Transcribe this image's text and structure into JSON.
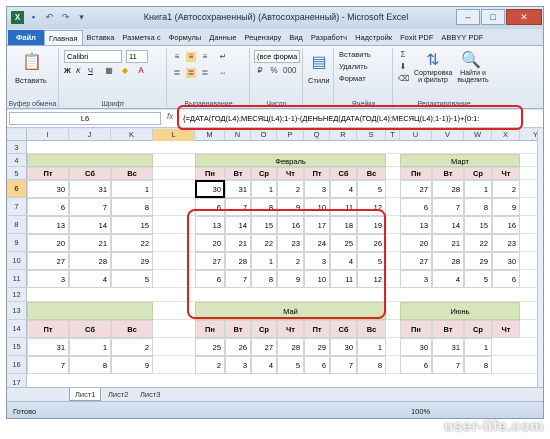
{
  "title": "Книга1 (Автосохраненный) (Автосохраненный) - Microsoft Excel",
  "tabs": [
    "Файл",
    "Главная",
    "Вставка",
    "Разметка с",
    "Формулы",
    "Данные",
    "Рецензиру",
    "Вид",
    "Разработч",
    "Надстройк",
    "Foxit PDF",
    "ABBYY PDF"
  ],
  "ribbon": {
    "paste": "Вставить",
    "clipboard": "Буфер обмена",
    "font_name": "Calibri",
    "font_size": "11",
    "font": "Шрифт",
    "alignment": "Выравнивание",
    "number_format": "(все форма",
    "number": "Число",
    "styles": "Стили",
    "insert": "Вставить",
    "delete": "Удалить",
    "format": "Формат",
    "cells": "Ячейки",
    "sort": "Сортировка и фильтр",
    "find": "Найти и выделить",
    "editing": "Редактирование"
  },
  "namebox": "L6",
  "formula": "{=ДАТА(ГОД(L4);МЕСЯЦ(L4);1-1)-(ДЕНЬНЕД(ДАТА(ГОД(L4);МЕСЯЦ(L4);1-1))-1)+{0:1:",
  "columns": [
    "I",
    "J",
    "K",
    "L",
    "M",
    "N",
    "O",
    "P",
    "Q",
    "R",
    "S",
    "T",
    "U",
    "V",
    "W",
    "X",
    "Y"
  ],
  "rows": [
    "3",
    "4",
    "5",
    "6",
    "7",
    "8",
    "9",
    "10",
    "11",
    "12",
    "13",
    "14",
    "15",
    "16",
    "17"
  ],
  "days": [
    "Пн",
    "Вт",
    "Ср",
    "Чт",
    "Пт",
    "Сб",
    "Вс"
  ],
  "months": {
    "feb": "Февраль",
    "mar": "Март",
    "may": "Май",
    "jun": "Июнь"
  },
  "left_block": {
    "days": [
      "Пт",
      "Сб",
      "Вс"
    ],
    "rows": [
      [
        "30",
        "31",
        "1"
      ],
      [
        "6",
        "7",
        "8"
      ],
      [
        "13",
        "14",
        "15"
      ],
      [
        "20",
        "21",
        "22"
      ],
      [
        "27",
        "28",
        "29"
      ],
      [
        "3",
        "4",
        "5"
      ]
    ]
  },
  "feb_block": [
    [
      "30",
      "31",
      "1",
      "2",
      "3",
      "4",
      "5"
    ],
    [
      "6",
      "7",
      "8",
      "9",
      "10",
      "11",
      "12"
    ],
    [
      "13",
      "14",
      "15",
      "16",
      "17",
      "18",
      "19"
    ],
    [
      "20",
      "21",
      "22",
      "23",
      "24",
      "25",
      "26"
    ],
    [
      "27",
      "28",
      "1",
      "2",
      "3",
      "4",
      "5"
    ],
    [
      "6",
      "7",
      "8",
      "9",
      "10",
      "11",
      "12"
    ]
  ],
  "mar_block": [
    [
      "27",
      "28",
      "1",
      "2"
    ],
    [
      "6",
      "7",
      "8",
      "9"
    ],
    [
      "13",
      "14",
      "15",
      "16"
    ],
    [
      "20",
      "21",
      "22",
      "23"
    ],
    [
      "27",
      "28",
      "29",
      "30"
    ],
    [
      "3",
      "4",
      "5",
      "6"
    ]
  ],
  "left_block2": [
    [
      "31",
      "1",
      "2"
    ],
    [
      "7",
      "8",
      "9"
    ]
  ],
  "may_block": [
    [
      "25",
      "26",
      "27",
      "28",
      "29",
      "30",
      "1"
    ],
    [
      "2",
      "3",
      "4",
      "5",
      "6",
      "7",
      "8"
    ]
  ],
  "jun_block": [
    [
      "30",
      "31",
      "1"
    ],
    [
      "6",
      "7",
      "8"
    ]
  ],
  "sheets": [
    "Лист1",
    "Лист2",
    "Лист3"
  ],
  "status": {
    "ready": "Готово",
    "zoom": "100%"
  },
  "watermark": "user-life.com"
}
